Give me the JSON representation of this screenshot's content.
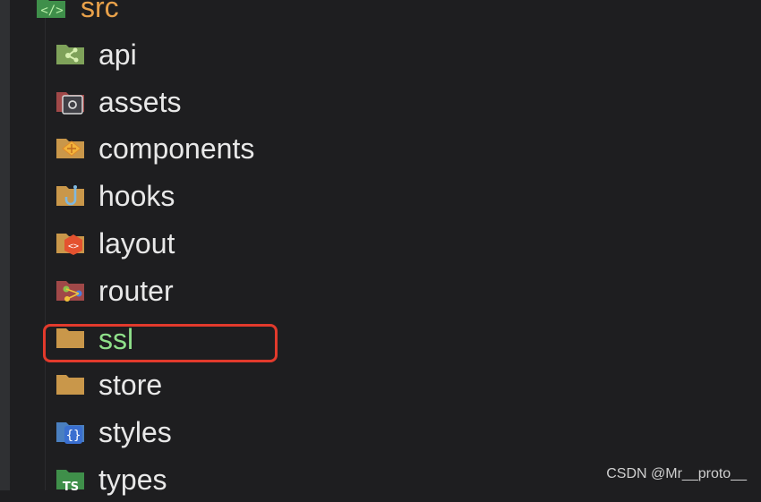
{
  "tree": {
    "root": {
      "label": "src",
      "icon": "folder-source-icon"
    },
    "items": [
      {
        "label": "api",
        "icon": "folder-api-icon"
      },
      {
        "label": "assets",
        "icon": "folder-assets-icon"
      },
      {
        "label": "components",
        "icon": "folder-components-icon"
      },
      {
        "label": "hooks",
        "icon": "folder-hooks-icon"
      },
      {
        "label": "layout",
        "icon": "folder-layout-icon"
      },
      {
        "label": "router",
        "icon": "folder-router-icon"
      },
      {
        "label": "ssl",
        "icon": "folder-icon",
        "selected": true
      },
      {
        "label": "store",
        "icon": "folder-icon"
      },
      {
        "label": "styles",
        "icon": "folder-styles-icon"
      },
      {
        "label": "types",
        "icon": "folder-typescript-icon"
      }
    ]
  },
  "colors": {
    "background": "#1e1e20",
    "root_label": "#e8a14a",
    "selected_label": "#8fe08a",
    "highlight_box": "#e23a2c"
  },
  "watermark": "CSDN @Mr__proto__"
}
